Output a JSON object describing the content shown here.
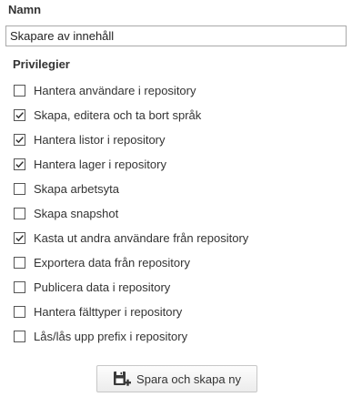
{
  "form": {
    "name_label": "Namn",
    "name_value": "Skapare av innehåll",
    "privileges_label": "Privilegier",
    "privileges": [
      {
        "label": "Hantera användare i repository",
        "checked": false
      },
      {
        "label": "Skapa, editera och ta bort språk",
        "checked": true
      },
      {
        "label": "Hantera listor i repository",
        "checked": true
      },
      {
        "label": "Hantera lager i repository",
        "checked": true
      },
      {
        "label": "Skapa arbetsyta",
        "checked": false
      },
      {
        "label": "Skapa snapshot",
        "checked": false
      },
      {
        "label": "Kasta ut andra användare från repository",
        "checked": true
      },
      {
        "label": "Exportera data från repository",
        "checked": false
      },
      {
        "label": "Publicera data i repository",
        "checked": false
      },
      {
        "label": "Hantera fälttyper i repository",
        "checked": false
      },
      {
        "label": "Lås/lås upp prefix i repository",
        "checked": false
      }
    ],
    "save_button_label": "Spara och skapa ny",
    "save_button_icon": "save-new-icon"
  }
}
